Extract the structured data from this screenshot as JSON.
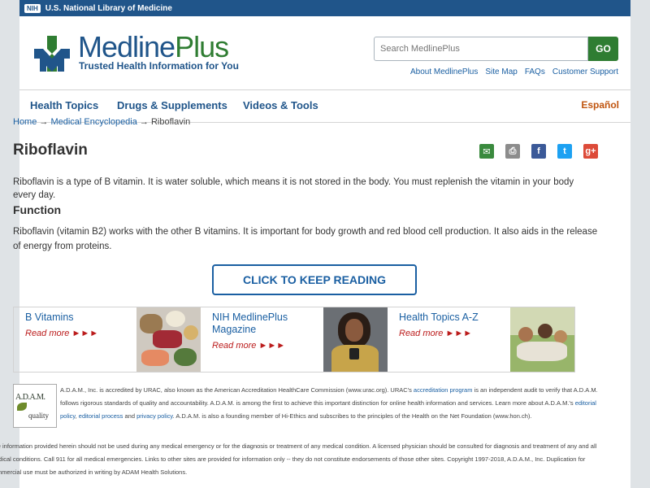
{
  "topbar": {
    "badge": "NIH",
    "label": "U.S. National Library of Medicine"
  },
  "brand": {
    "title_main": "Medline",
    "title_plus": "Plus",
    "tagline": "Trusted Health Information for You"
  },
  "search": {
    "placeholder": "Search MedlinePlus",
    "button": "GO"
  },
  "utility_links": [
    "About MedlinePlus",
    "Site Map",
    "FAQs",
    "Customer Support"
  ],
  "nav": {
    "items": [
      "Health Topics",
      "Drugs & Supplements",
      "Videos & Tools"
    ],
    "spanish": "Español"
  },
  "breadcrumb": {
    "home": "Home",
    "sep1": "→",
    "encyclopedia": "Medical Encyclopedia",
    "sep2": "→",
    "current": "Riboflavin"
  },
  "article": {
    "title": "Riboflavin",
    "intro": "Riboflavin is a type of B vitamin. It is water soluble, which means it is not stored in the body. You must replenish the vitamin in your body every day.",
    "function_heading": "Function",
    "function_text": "Riboflavin (vitamin B2) works with the other B vitamins. It is important for body growth and red blood cell production. It also aids in the release of energy from proteins.",
    "keep_reading": "CLICK TO KEEP READING"
  },
  "share_icons": [
    "email-icon",
    "print-icon",
    "facebook-icon",
    "twitter-icon",
    "google-plus-icon"
  ],
  "share_glyphs": [
    "✉",
    "⎙",
    "f",
    "t",
    "g+"
  ],
  "cards": [
    {
      "title": "B Vitamins",
      "more": "Read more ►►►"
    },
    {
      "title": "NIH MedlinePlus Magazine",
      "more": "Read more ►►►"
    },
    {
      "title": "Health Topics A-Z",
      "more": "Read more ►►►"
    }
  ],
  "adam": {
    "logo_main": "A.D.A.M.",
    "logo_sub": "quality",
    "text_1": "A.D.A.M., Inc. is accredited by URAC, also known as the American Accreditation HealthCare Commission (www.urac.org). URAC's ",
    "link_1": "accreditation program",
    "text_2": " is an independent audit to verify that A.D.A.M. follows rigorous standards of quality and accountability. A.D.A.M. is among the first to achieve this important distinction for online health information and services. Learn more about A.D.A.M.'s ",
    "link_2": "editorial policy",
    "text_3": ", ",
    "link_3": "editorial process",
    "text_4": " and ",
    "link_4": "privacy policy",
    "text_5": ". A.D.A.M. is also a founding member of Hi-Ethics and subscribes to the principles of the Health on the Net Foundation (www.hon.ch)."
  },
  "disclaimer": "The information provided herein should not be used during any medical emergency or for the diagnosis or treatment of any medical condition. A licensed physician should be consulted for diagnosis and treatment of any and all medical conditions. Call 911 for all medical emergencies. Links to other sites are provided for information only -- they do not constitute endorsements of those other sites. Copyright 1997-2018, A.D.A.M., Inc. Duplication for commercial use must be authorized in writing by ADAM Health Solutions.",
  "colors": {
    "nih_blue": "#20558a",
    "green": "#2f7d32",
    "link": "#1a5fa2",
    "spanish": "#c0550f",
    "read_more": "#bb1c1c"
  }
}
